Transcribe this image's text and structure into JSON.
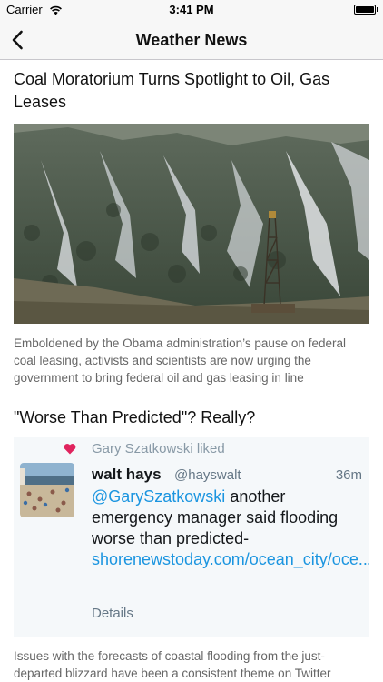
{
  "status_bar": {
    "carrier": "Carrier",
    "time": "3:41 PM",
    "battery_level": 1.0
  },
  "nav": {
    "title": "Weather News",
    "back_icon": "chevron-left-icon"
  },
  "articles": [
    {
      "title": "Coal Moratorium Turns Spotlight to Oil, Gas Leases",
      "image": "drilling-rig-mountain-photo",
      "summary": "Emboldened by the Obama administration’s pause on federal coal leasing, activists and scientists are now urging the government to bring federal oil and gas leasing in line"
    },
    {
      "title": "\"Worse Than Predicted\"? Really?",
      "tweet": {
        "liked_by": "Gary Szatkowski liked",
        "name": "walt hays",
        "handle": "@hayswalt",
        "time": "36m",
        "mention": "@GarySzatkowski",
        "text": " another emergency manager said flooding worse than predicted-",
        "link": "shorenewstoday.com/ocean_city/oce...",
        "details": "Details",
        "heart_color": "#e0245e"
      },
      "summary": "Issues with the forecasts of coastal flooding from the just-departed blizzard have been a consistent theme on Twitter"
    }
  ]
}
